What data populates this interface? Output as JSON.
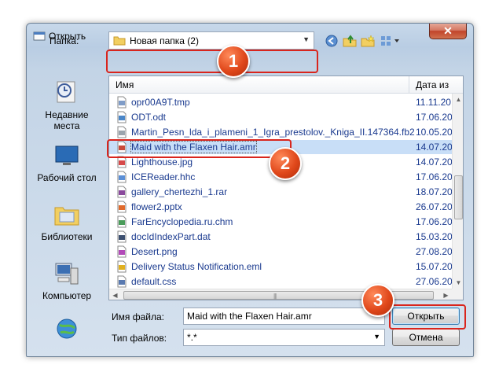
{
  "window": {
    "title": "Открыть",
    "close_glyph": "✕"
  },
  "toolbar": {
    "folder_label": "Папка:",
    "folder_value": "Новая папка (2)",
    "dropdown_glyph": "▼"
  },
  "places": [
    {
      "label": "Недавние места",
      "icon": "recent-places-icon"
    },
    {
      "label": "Рабочий стол",
      "icon": "desktop-icon"
    },
    {
      "label": "Библиотеки",
      "icon": "libraries-icon"
    },
    {
      "label": "Компьютер",
      "icon": "computer-icon"
    },
    {
      "label": "",
      "icon": "network-icon"
    }
  ],
  "file_list": {
    "columns": {
      "name": "Имя",
      "date": "Дата из"
    },
    "rows": [
      {
        "name": "opr00A9T.tmp",
        "date": "11.11.20",
        "icon": "tmp-file-icon"
      },
      {
        "name": "ODT.odt",
        "date": "17.06.20",
        "icon": "odt-file-icon"
      },
      {
        "name": "Martin_Pesn_lda_i_plameni_1_Igra_prestolov._Kniga_II.147364.fb2",
        "date": "10.05.20",
        "icon": "fb2-file-icon"
      },
      {
        "name": "Maid with the Flaxen Hair.amr",
        "date": "14.07.20",
        "icon": "amr-file-icon",
        "selected": true
      },
      {
        "name": "Lighthouse.jpg",
        "date": "14.07.20",
        "icon": "jpg-file-icon"
      },
      {
        "name": "ICEReader.hhc",
        "date": "17.06.20",
        "icon": "hhc-file-icon"
      },
      {
        "name": "gallery_chertezhi_1.rar",
        "date": "18.07.20",
        "icon": "rar-file-icon"
      },
      {
        "name": "flower2.pptx",
        "date": "26.07.20",
        "icon": "pptx-file-icon"
      },
      {
        "name": "FarEncyclopedia.ru.chm",
        "date": "17.06.20",
        "icon": "chm-file-icon"
      },
      {
        "name": "docIdIndexPart.dat",
        "date": "15.03.20",
        "icon": "dat-file-icon"
      },
      {
        "name": "Desert.png",
        "date": "27.08.20",
        "icon": "png-file-icon"
      },
      {
        "name": "Delivery Status Notification.eml",
        "date": "15.07.20",
        "icon": "eml-file-icon"
      },
      {
        "name": "default.css",
        "date": "27.06.20",
        "icon": "css-file-icon"
      }
    ]
  },
  "form": {
    "filename_label": "Имя файла:",
    "filename_value": "Maid with the Flaxen Hair.amr",
    "filetype_label": "Тип файлов:",
    "filetype_value": "*.*",
    "open_button": "Открыть",
    "cancel_button": "Отмена"
  },
  "annotations": [
    "1",
    "2",
    "3"
  ],
  "colors": {
    "highlight": "#d9251d",
    "badge": "#e0481b",
    "selection": "#c8def7",
    "link_text": "#1a3a8f"
  }
}
